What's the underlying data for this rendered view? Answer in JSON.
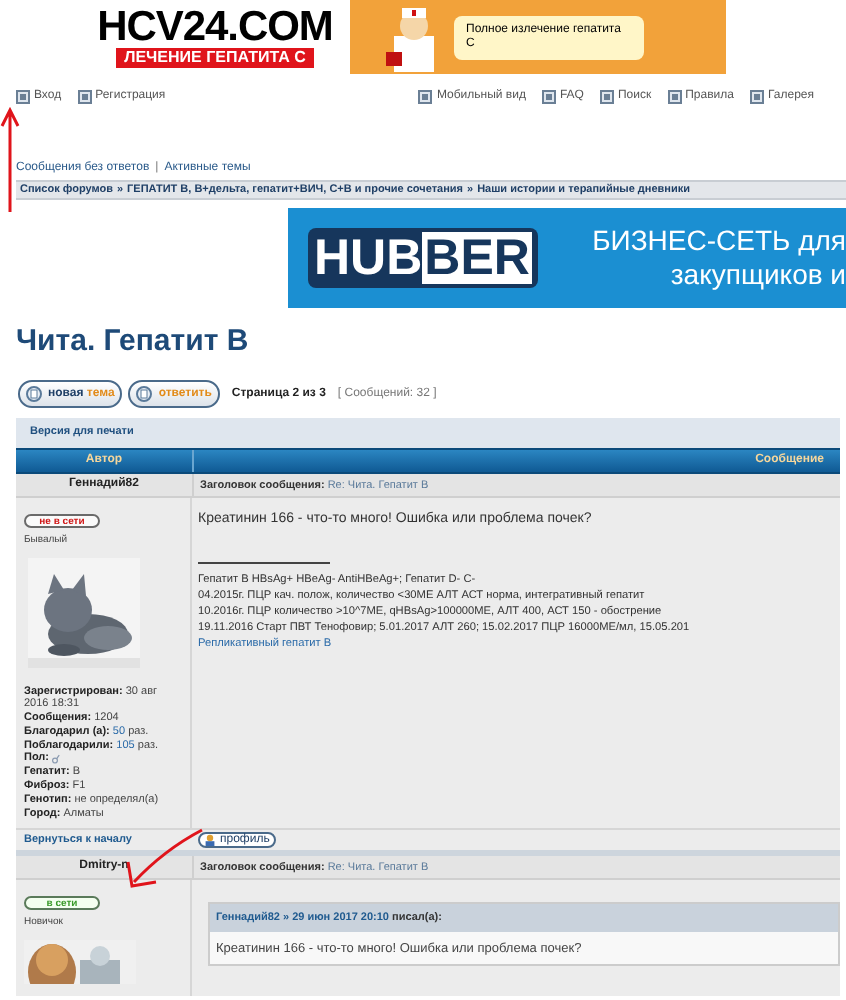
{
  "top_banner": {
    "brand": "HCV24.COM",
    "tagline": "ЛЕЧЕНИЕ ГЕПАТИТА С",
    "bubble": "Полное излечение гепатита С"
  },
  "nav_left": [
    {
      "label": "Вход"
    },
    {
      "label": "Регистрация"
    }
  ],
  "nav_right": [
    {
      "label": "Мобильный вид"
    },
    {
      "label": "FAQ"
    },
    {
      "label": "Поиск"
    },
    {
      "label": "Правила"
    },
    {
      "label": "Галерея"
    }
  ],
  "quick_links": {
    "items": [
      "Сообщения без ответов",
      "Активные темы"
    ],
    "separator": "|"
  },
  "breadcrumbs": {
    "items": [
      "Список форумов",
      "ГЕПАТИТ B, B+дельта, гепатит+ВИЧ, C+B и прочие сочетания",
      "Наши истории и терапийные дневники"
    ],
    "separator": "»"
  },
  "ad_banner": {
    "logo_left": "HUB",
    "logo_right": "BER",
    "lines": [
      "БИЗНЕС-СЕТЬ для",
      "закупщиков и"
    ]
  },
  "topic_title": "Чита. Гепатит B",
  "action_buttons": [
    {
      "label": "новая",
      "accent": "тема"
    },
    {
      "label": "ответить"
    }
  ],
  "pagination": "Страница 2 из 3",
  "post_count": "[ Сообщений: 32 ]",
  "print_link": "Версия для печати",
  "columns": [
    "Автор",
    "Сообщение"
  ],
  "posts": [
    {
      "author": "Геннадий82",
      "subject_label": "Заголовок сообщения:",
      "subject": "Re: Чита. Гепатит B",
      "online": false,
      "status_label": "не в сети",
      "rank": "Бывалый",
      "avatar": {
        "kind": "picture"
      },
      "details": [
        {
          "kind": "text",
          "label": "Зарегистрирован:",
          "value": "30 авг 2016 18:31",
          "link": false
        },
        {
          "kind": "text",
          "label": "Сообщения:",
          "value": "1204",
          "link": false
        },
        {
          "kind": "text",
          "label": "Благодарил (а):",
          "value": "50",
          "unit": "раз.",
          "link": true
        },
        {
          "kind": "text",
          "label": "Поблагодарили:",
          "value": "105",
          "unit": "раз.",
          "link": true
        },
        {
          "kind": "icon",
          "label": "Пол:"
        },
        {
          "kind": "text",
          "label": "Гепатит:",
          "value": "B",
          "link": false
        },
        {
          "kind": "text",
          "label": "Фиброз:",
          "value": "F1",
          "link": false
        },
        {
          "kind": "text",
          "label": "Генотип:",
          "value": "не определял(а)",
          "link": false
        },
        {
          "kind": "text",
          "label": "Город:",
          "value": "Алматы",
          "link": false
        }
      ],
      "body": "Креатинин 166 - что-то много! Ошибка или проблема почек?",
      "signature": [
        "Гепатит B HBsAg+ HBeAg- AntiHBeAg+; Гепатит D- C-",
        "04.2015г. ПЦР кач. полож, количество <30МЕ АЛТ АСТ норма, интегративный гепатит",
        "10.2016г. ПЦР количество >10^7МЕ, qHBsAg>100000МЕ, АЛТ 400, АСТ 150 - обострение",
        "19.11.2016 Старт ПВТ Тенофовир; 5.01.2017 АЛТ 260; 15.02.2017 ПЦР 16000МЕ/мл, 15.05.201"
      ],
      "signature_link": "Репликативный гепатит B",
      "back_link": "Вернуться к началу",
      "profile_button": "профиль"
    },
    {
      "author": "Dmitry-n",
      "subject_label": "Заголовок сообщения:",
      "subject": "Re: Чита. Гепатит B",
      "online": true,
      "status_label": "в сети",
      "rank": "Новичок",
      "avatar": {
        "kind": "picture"
      },
      "quote": {
        "author": "Геннадий82",
        "separator": "»",
        "date": "29 июн 2017 20:10",
        "wrote": "писал(а):",
        "text": "Креатинин 166 - что-то много! Ошибка или проблема почек?"
      }
    }
  ]
}
